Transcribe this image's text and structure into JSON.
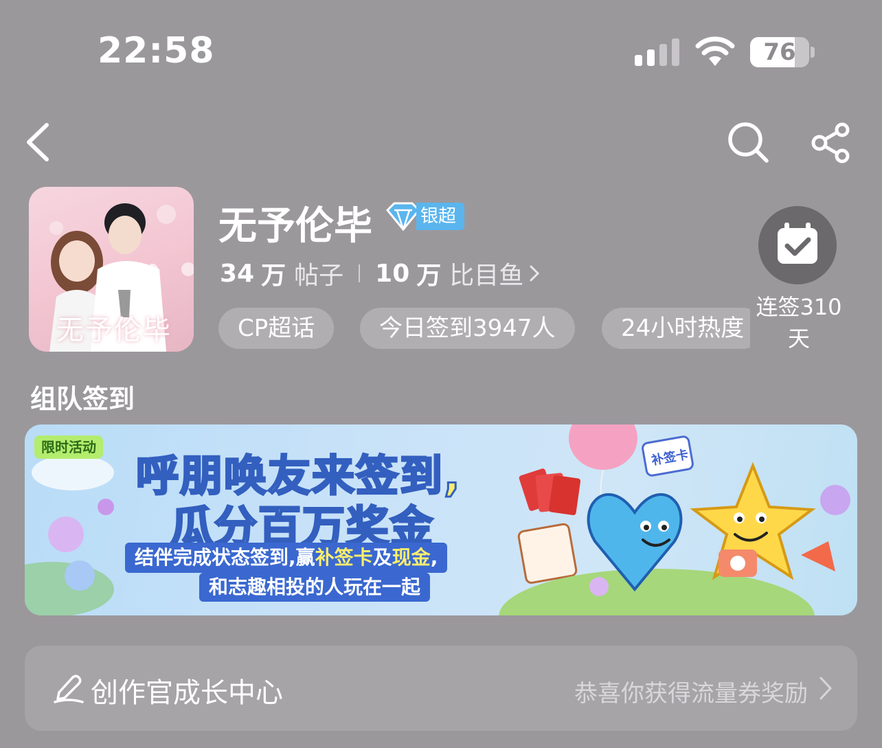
{
  "status_bar": {
    "time": "22:58",
    "battery": "76",
    "battery_level": 0.76
  },
  "community": {
    "name": "无予伦毕",
    "level_badge": "银超",
    "cover_text": "无予伦毕",
    "posts_count": "34",
    "posts_unit": "万",
    "posts_label": "帖子",
    "fans_count": "10",
    "fans_unit": "万",
    "fans_label": "比目鱼",
    "tags": [
      "CP超话",
      "今日签到3947人",
      "24小时热度"
    ],
    "checkin_status": "连签310天"
  },
  "team_checkin": {
    "title": "组队签到",
    "banner": {
      "tag": "限时活动",
      "headline1_a": "呼朋唤友来",
      "headline1_b": "签到,",
      "headline2_a": "瓜分",
      "headline2_b": "百万",
      "headline2_c": "奖金",
      "sub1_a": "结伴完成状态签到,赢",
      "sub1_b": "补签卡",
      "sub1_c": "及",
      "sub1_d": "现金",
      "sub1_e": ",",
      "sub2": "和志趣相投的人玩在一起",
      "card_label": "补签卡"
    }
  },
  "creator_center": {
    "title": "创作官成长中心",
    "promo": "恭喜你获得流量券奖励"
  },
  "colors": {
    "badge": "#5ab5ee",
    "banner_text_outline": "#335fbf",
    "highlight_yellow": "#fcee6c"
  }
}
